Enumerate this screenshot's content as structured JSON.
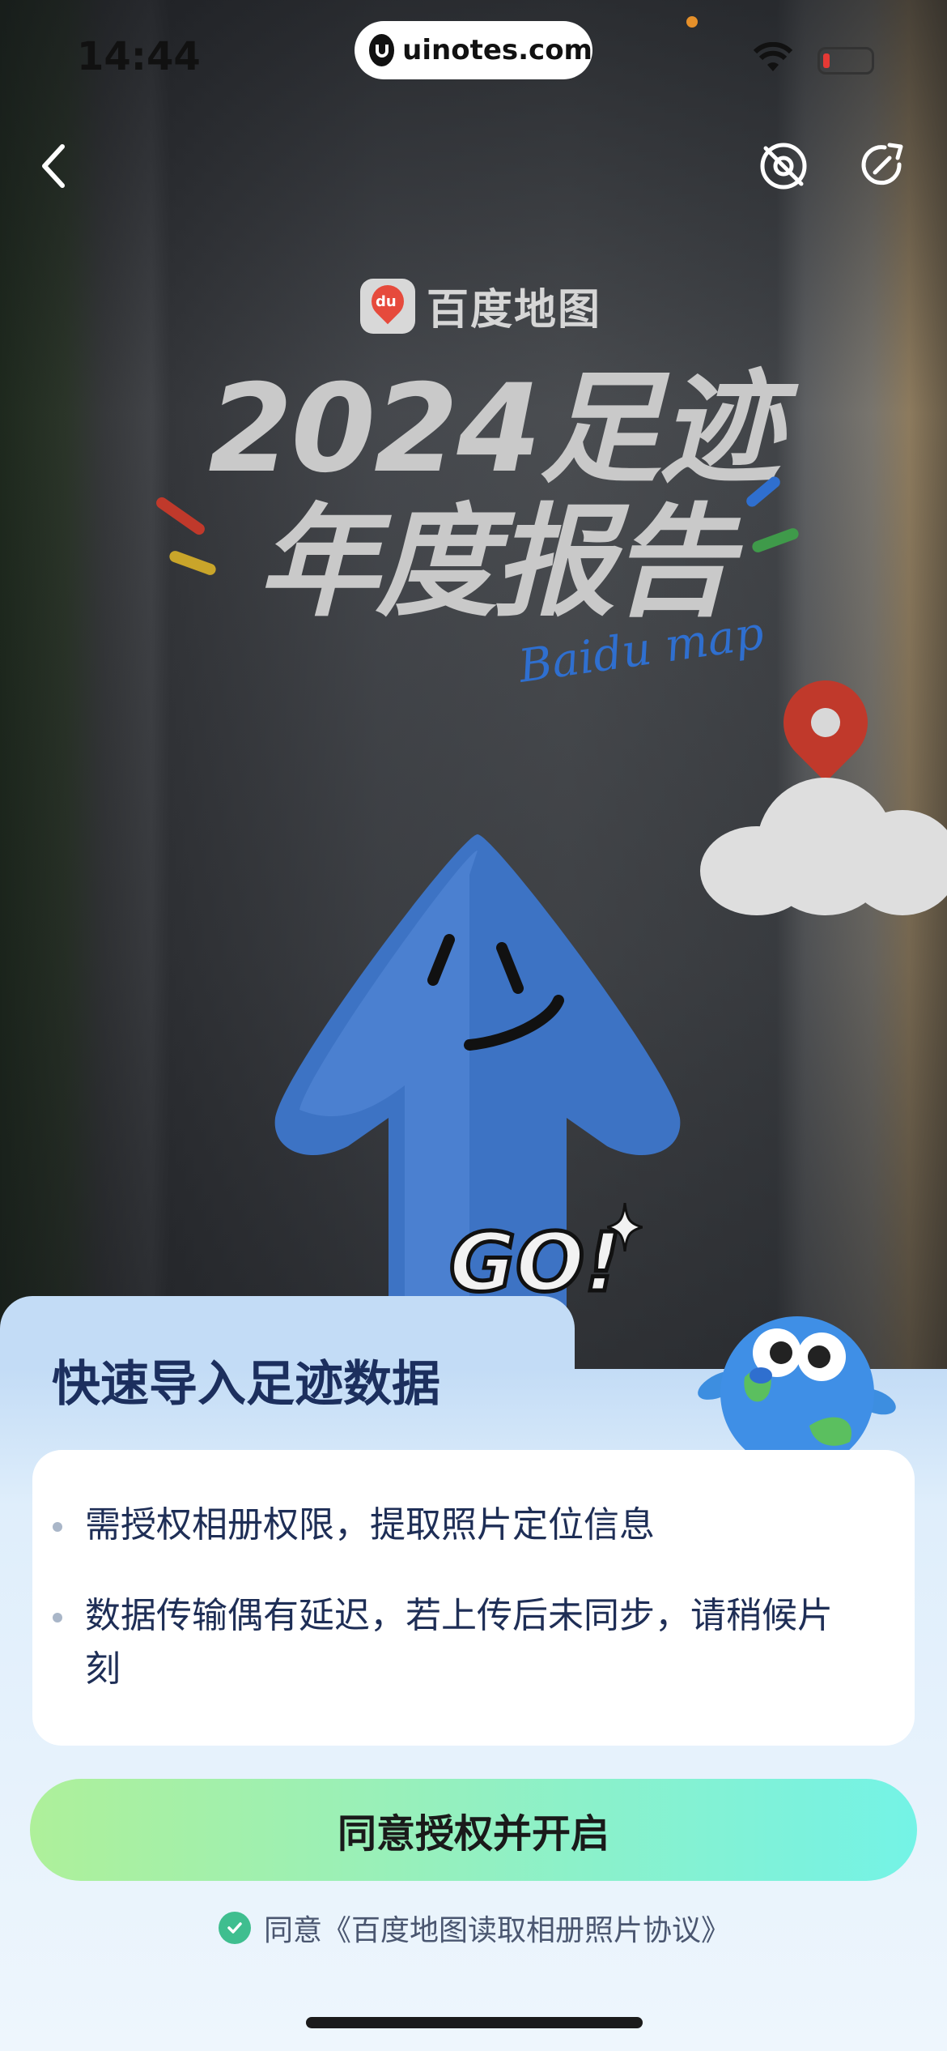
{
  "status_bar": {
    "time": "14:44"
  },
  "watermark": {
    "text": "uinotes.com"
  },
  "header": {
    "back_icon": "chevron-left-icon",
    "icons": [
      "no-location-icon",
      "share-icon"
    ]
  },
  "brand": {
    "name": "百度地图",
    "logo_text": "du"
  },
  "hero": {
    "title_line1": "2024足迹",
    "title_line2": "年度报告",
    "signature": "Baidu map",
    "badge": "GO!"
  },
  "sheet": {
    "title": "快速导入足迹数据",
    "bullets": [
      "需授权相册权限，提取照片定位信息",
      "数据传输偶有延迟，若上传后未同步，请稍候片刻"
    ],
    "cta_label": "同意授权并开启",
    "agreement": "同意《百度地图读取相册照片协议》"
  },
  "colors": {
    "accent_green": "#3fbe8f",
    "title_navy": "#1c2f5e",
    "pin_red": "#c0392b"
  }
}
